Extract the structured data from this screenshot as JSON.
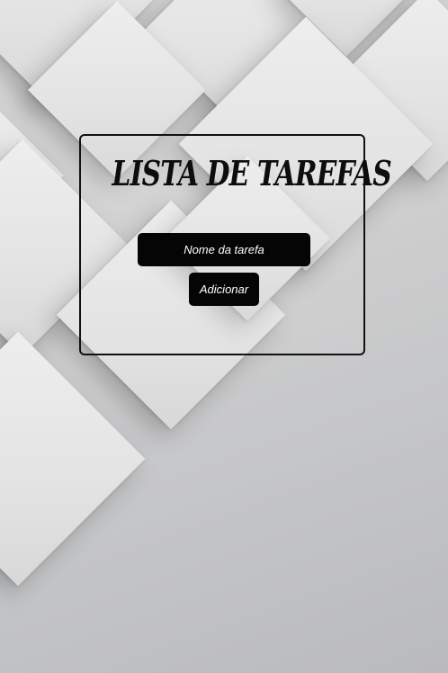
{
  "app": {
    "title": "LISTA DE TAREFAS"
  },
  "form": {
    "task_input": {
      "value": "",
      "placeholder": "Nome da tarefa"
    },
    "add_label": "Adicionar"
  },
  "colors": {
    "button_bg": "#050505",
    "button_text": "#ffffff",
    "panel_border": "#111111",
    "background": "#d0d0d0"
  }
}
